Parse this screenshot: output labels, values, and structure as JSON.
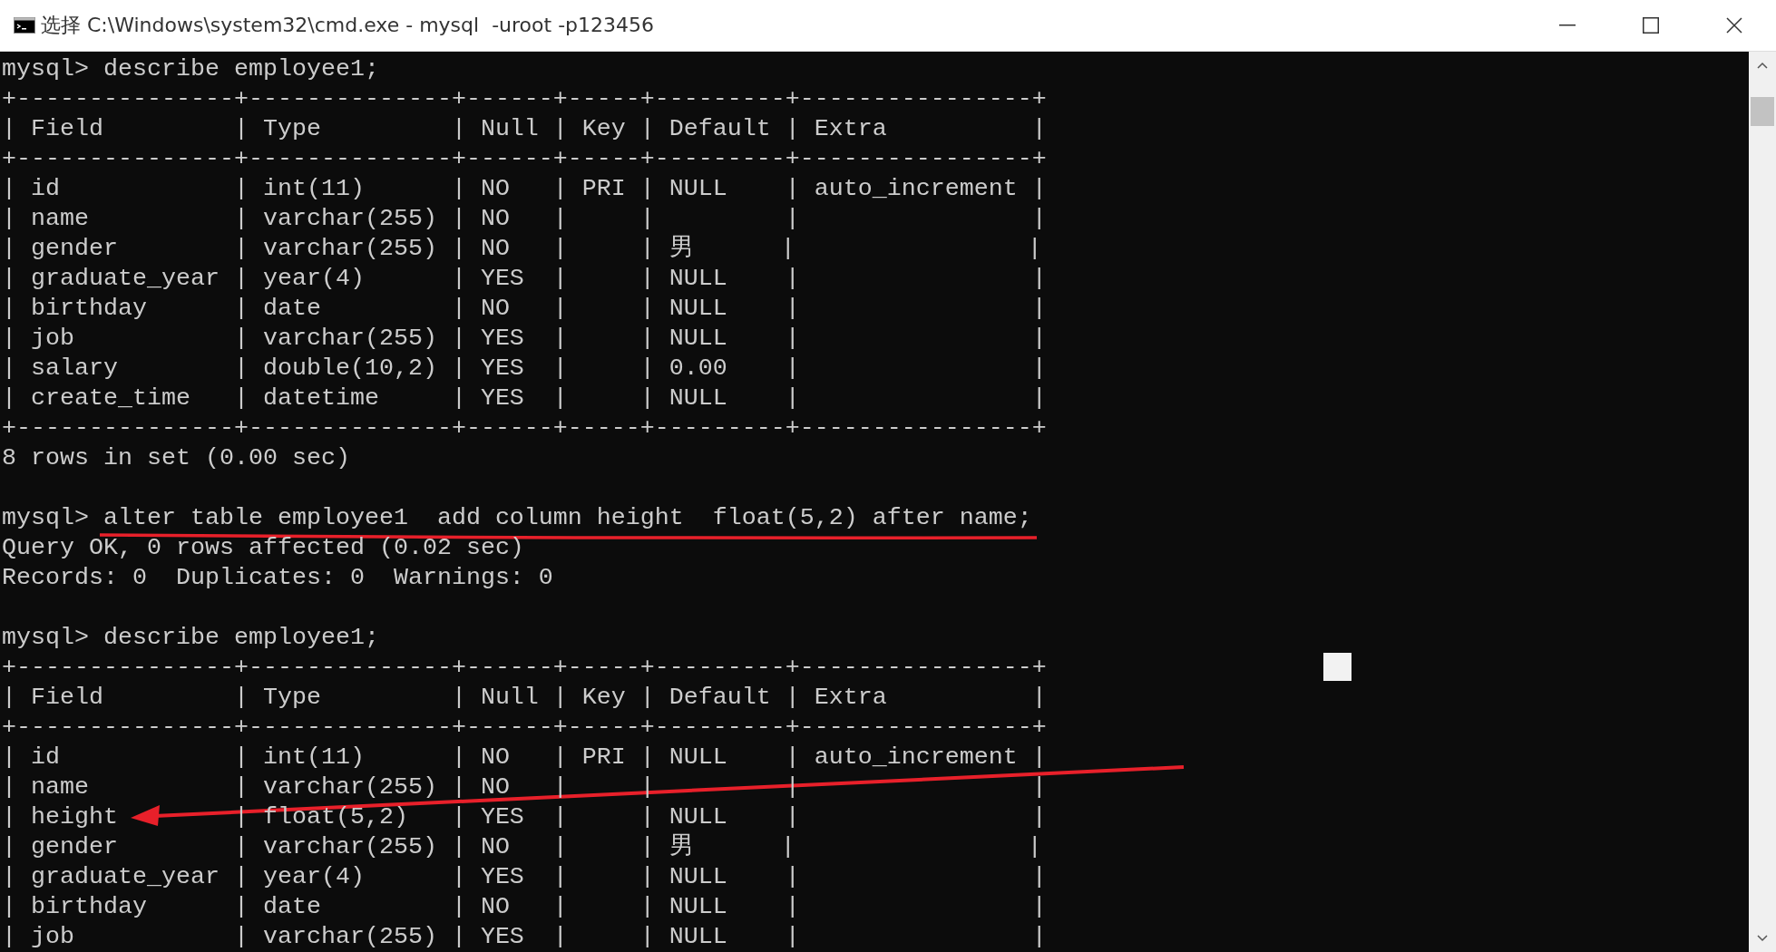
{
  "window": {
    "title": "选择 C:\\Windows\\system32\\cmd.exe - mysql  -uroot -p123456"
  },
  "console": {
    "blocks": [
      {
        "lines": [
          "mysql> describe employee1;",
          "+---------------+--------------+------+-----+---------+----------------+",
          "| Field         | Type         | Null | Key | Default | Extra          |",
          "+---------------+--------------+------+-----+---------+----------------+",
          "| id            | int(11)      | NO   | PRI | NULL    | auto_increment |",
          "| name          | varchar(255) | NO   |     |         |                |",
          "| gender        | varchar(255) | NO   |     | 男      |                |",
          "| graduate_year | year(4)      | YES  |     | NULL    |                |",
          "| birthday      | date         | NO   |     | NULL    |                |",
          "| job           | varchar(255) | YES  |     | NULL    |                |",
          "| salary        | double(10,2) | YES  |     | 0.00    |                |",
          "| create_time   | datetime     | YES  |     | NULL    |                |",
          "+---------------+--------------+------+-----+---------+----------------+",
          "8 rows in set (0.00 sec)"
        ]
      },
      {
        "lines": [
          "mysql> alter table employee1  add column height  float(5,2) after name;",
          "Query OK, 0 rows affected (0.02 sec)",
          "Records: 0  Duplicates: 0  Warnings: 0"
        ]
      },
      {
        "lines": [
          "mysql> describe employee1;",
          "+---------------+--------------+------+-----+---------+----------------+",
          "| Field         | Type         | Null | Key | Default | Extra          |",
          "+---------------+--------------+------+-----+---------+----------------+",
          "| id            | int(11)      | NO   | PRI | NULL    | auto_increment |",
          "| name          | varchar(255) | NO   |     |         |                |",
          "| height        | float(5,2)   | YES  |     | NULL    |                |",
          "| gender        | varchar(255) | NO   |     | 男      |                |",
          "| graduate_year | year(4)      | YES  |     | NULL    |                |",
          "| birthday      | date         | NO   |     | NULL    |                |",
          "| job           | varchar(255) | YES  |     | NULL    |                |"
        ]
      }
    ]
  }
}
